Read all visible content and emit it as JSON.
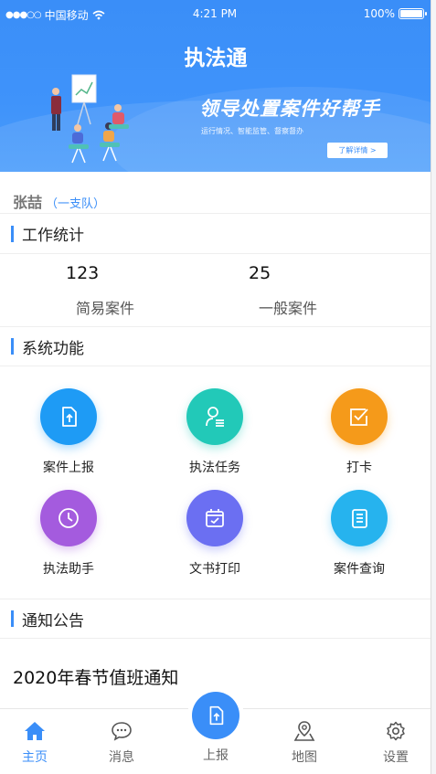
{
  "status_bar": {
    "carrier": "中国移动",
    "time": "4:21 PM",
    "battery": "100%",
    "battery_level": 1.0
  },
  "header": {
    "title": "执法通",
    "banner": {
      "slogan": "领导处置案件好帮手",
      "subtext": "运行情况、智能监管、督察督办",
      "more_label": "了解详情 >"
    }
  },
  "user": {
    "name": "张喆",
    "team": "（一支队）"
  },
  "stats": {
    "title": "工作统计",
    "items": [
      {
        "value": "123",
        "label": "简易案件"
      },
      {
        "value": "25",
        "label": "一般案件"
      }
    ]
  },
  "functions": {
    "title": "系统功能",
    "items": [
      {
        "label": "案件上报",
        "icon": "upload-doc-icon",
        "color": "#1e9bf5"
      },
      {
        "label": "执法任务",
        "icon": "person-task-icon",
        "color": "#22c9b8"
      },
      {
        "label": "打卡",
        "icon": "check-box-icon",
        "color": "#f59a1a"
      },
      {
        "label": "执法助手",
        "icon": "clock-icon",
        "color": "#a45bde"
      },
      {
        "label": "文书打印",
        "icon": "calendar-check-icon",
        "color": "#6b6ff2"
      },
      {
        "label": "案件查询",
        "icon": "notebook-icon",
        "color": "#26b3ee"
      }
    ]
  },
  "notices": {
    "title": "通知公告",
    "items": [
      {
        "title": "2020年春节值班通知"
      }
    ]
  },
  "tabbar": {
    "items": [
      {
        "label": "主页",
        "icon": "home-icon",
        "active": true
      },
      {
        "label": "消息",
        "icon": "message-icon",
        "active": false
      },
      {
        "label": "上报",
        "icon": "upload-doc-icon",
        "active": false
      },
      {
        "label": "地图",
        "icon": "map-pin-icon",
        "active": false
      },
      {
        "label": "设置",
        "icon": "gear-icon",
        "active": false
      }
    ]
  },
  "colors": {
    "accent": "#3a8ef8"
  }
}
